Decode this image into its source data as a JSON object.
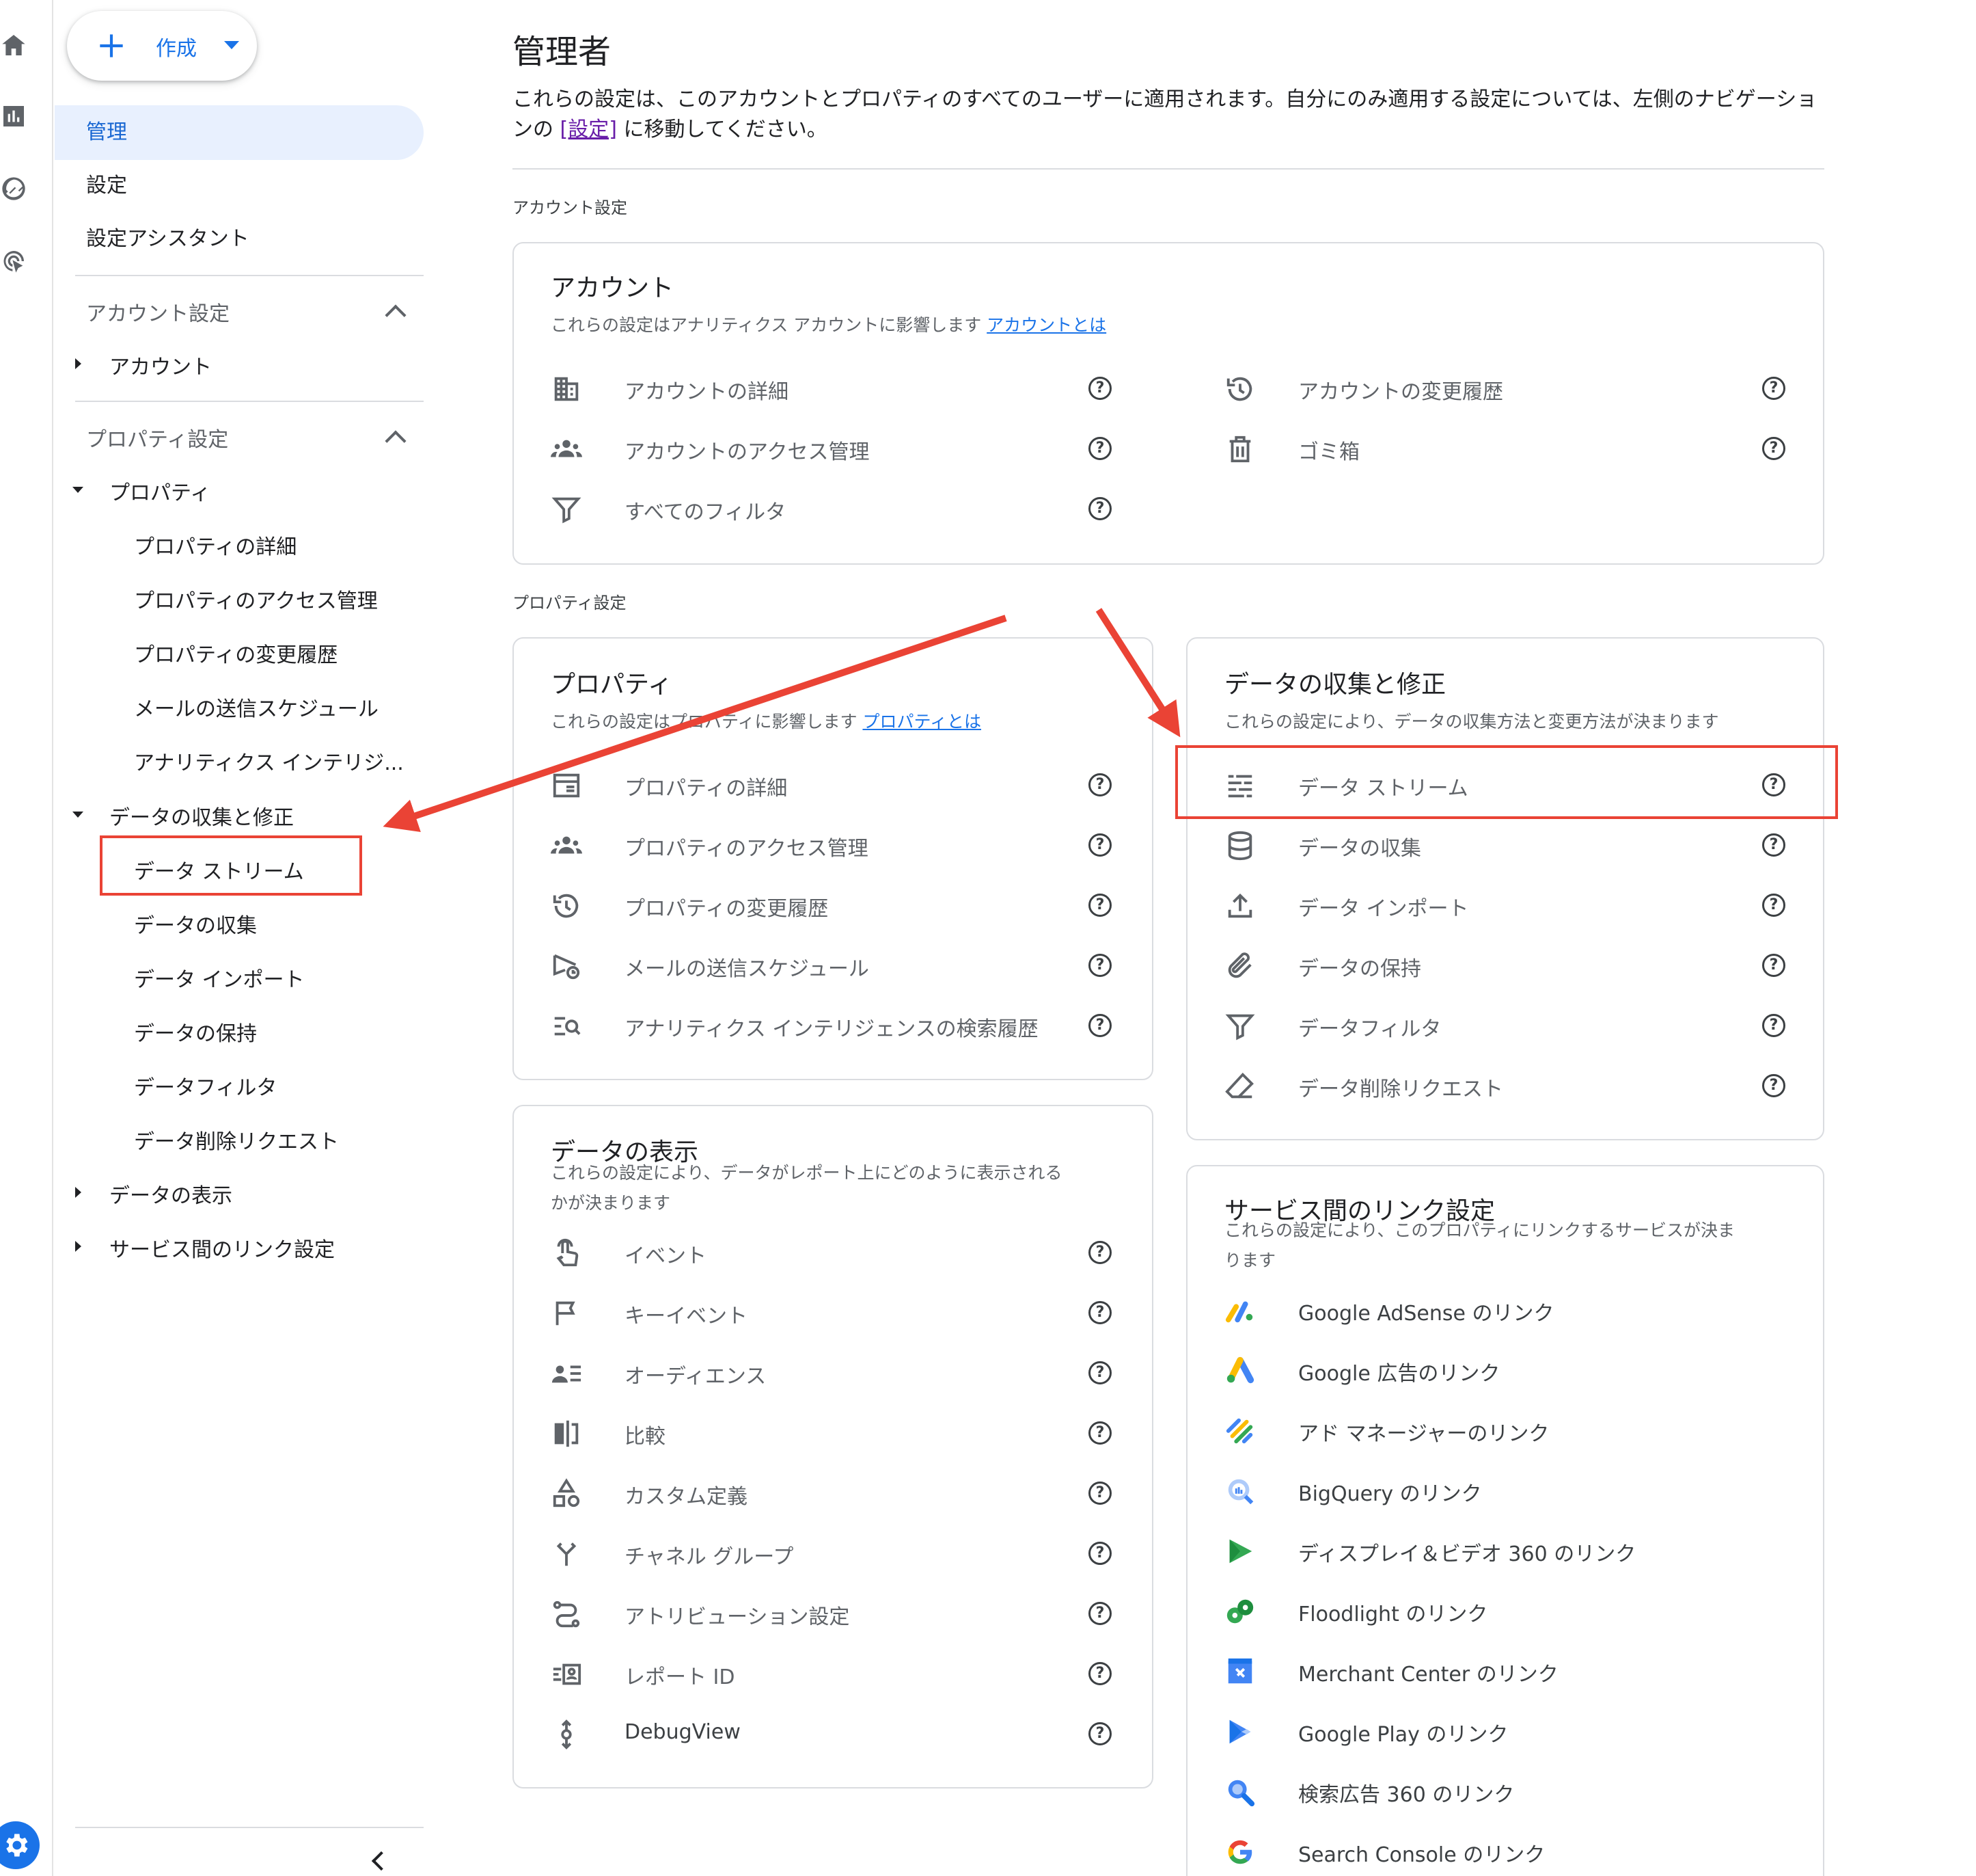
{
  "create_button": {
    "label": "作成"
  },
  "nav": {
    "top_items": [
      "管理",
      "設定",
      "設定アシスタント"
    ],
    "account_section": {
      "title": "アカウント設定",
      "items": [
        "アカウント"
      ]
    },
    "property_section": {
      "title": "プロパティ設定",
      "property_group": {
        "label": "プロパティ",
        "children": [
          "プロパティの詳細",
          "プロパティのアクセス管理",
          "プロパティの変更履歴",
          "メールの送信スケジュール",
          "アナリティクス インテリジ..."
        ]
      },
      "data_group": {
        "label": "データの収集と修正",
        "children": [
          "データ ストリーム",
          "データの収集",
          "データ インポート",
          "データの保持",
          "データフィルタ",
          "データ削除リクエスト"
        ]
      },
      "collapsed_groups": [
        "データの表示",
        "サービス間のリンク設定"
      ]
    }
  },
  "main": {
    "title": "管理者",
    "description_before": "これらの設定は、このアカウントとプロパティのすべてのユーザーに適用されます。自分にのみ適用する設定については、左側のナビゲーションの ",
    "description_link": "[設定]",
    "description_after": " に移動してください。",
    "account_settings_label": "アカウント設定",
    "property_settings_label": "プロパティ設定",
    "account_card": {
      "title": "アカウント",
      "subtitle": "これらの設定はアナリティクス アカウントに影響します ",
      "subtitle_link": "アカウントとは",
      "left_items": [
        "アカウントの詳細",
        "アカウントのアクセス管理",
        "すべてのフィルタ"
      ],
      "right_items": [
        "アカウントの変更履歴",
        "ゴミ箱"
      ]
    },
    "property_card": {
      "title": "プロパティ",
      "subtitle": "これらの設定はプロパティに影響します ",
      "subtitle_link": "プロパティとは",
      "items": [
        "プロパティの詳細",
        "プロパティのアクセス管理",
        "プロパティの変更履歴",
        "メールの送信スケジュール",
        "アナリティクス インテリジェンスの検索履歴"
      ]
    },
    "data_collection_card": {
      "title": "データの収集と修正",
      "subtitle": "これらの設定により、データの収集方法と変更方法が決まります",
      "items": [
        "データ ストリーム",
        "データの収集",
        "データ インポート",
        "データの保持",
        "データフィルタ",
        "データ削除リクエスト"
      ]
    },
    "data_display_card": {
      "title": "データの表示",
      "subtitle_line1": "これらの設定により、データがレポート上にどのように表示される",
      "subtitle_line2": "かが決まります",
      "items": [
        "イベント",
        "キーイベント",
        "オーディエンス",
        "比較",
        "カスタム定義",
        "チャネル グループ",
        "アトリビューション設定",
        "レポート ID",
        "DebugView"
      ]
    },
    "links_card": {
      "title": "サービス間のリンク設定",
      "subtitle_line1": "これらの設定により、このプロパティにリンクするサービスが決ま",
      "subtitle_line2": "ります",
      "items": [
        "Google AdSense のリンク",
        "Google 広告のリンク",
        "アド マネージャーのリンク",
        "BigQuery のリンク",
        "ディスプレイ＆ビデオ 360 のリンク",
        "Floodlight のリンク",
        "Merchant Center のリンク",
        "Google Play のリンク",
        "検索広告 360 のリンク",
        "Search Console のリンク"
      ]
    },
    "help_glyph": "?"
  },
  "colors": {
    "accent": "#1a73e8",
    "active_bg": "#e8f0fe",
    "highlight": "#ea4335",
    "link_visited": "#681da8"
  }
}
